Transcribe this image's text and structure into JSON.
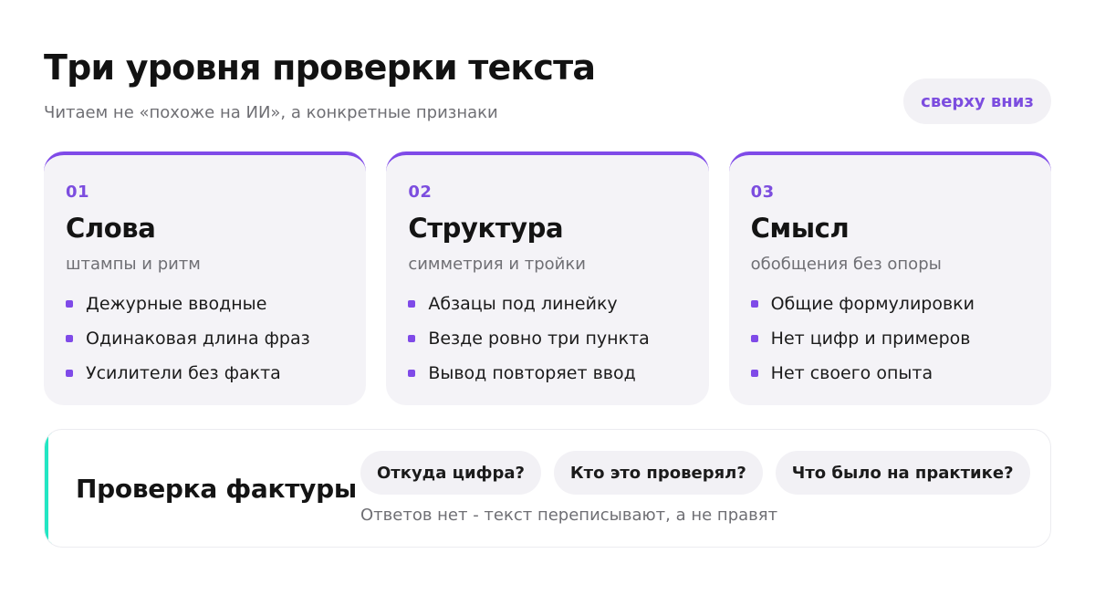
{
  "header": {
    "title": "Три уровня проверки текста",
    "subtitle": "Читаем не «похоже на ИИ», а конкретные признаки",
    "badge": "сверху вниз"
  },
  "cards": [
    {
      "num": "01",
      "title": "Слова",
      "subtitle": "штампы и ритм",
      "items": [
        "Дежурные вводные",
        "Одинаковая длина фраз",
        "Усилители без факта"
      ]
    },
    {
      "num": "02",
      "title": "Структура",
      "subtitle": "симметрия и тройки",
      "items": [
        "Абзацы под линейку",
        "Везде ровно три пункта",
        "Вывод повторяет ввод"
      ]
    },
    {
      "num": "03",
      "title": "Смысл",
      "subtitle": "обобщения без опоры",
      "items": [
        "Общие формулировки",
        "Нет цифр и примеров",
        "Нет своего опыта"
      ]
    }
  ],
  "fact_check": {
    "title": "Проверка фактуры",
    "questions": [
      "Откуда цифра?",
      "Кто это проверял?",
      "Что было на практике?"
    ],
    "note": "Ответов нет - текст переписывают, а не правят"
  },
  "colors": {
    "accent": "#7f4ae8",
    "teal": "#22e6c3",
    "card_bg": "#f4f3f7"
  }
}
